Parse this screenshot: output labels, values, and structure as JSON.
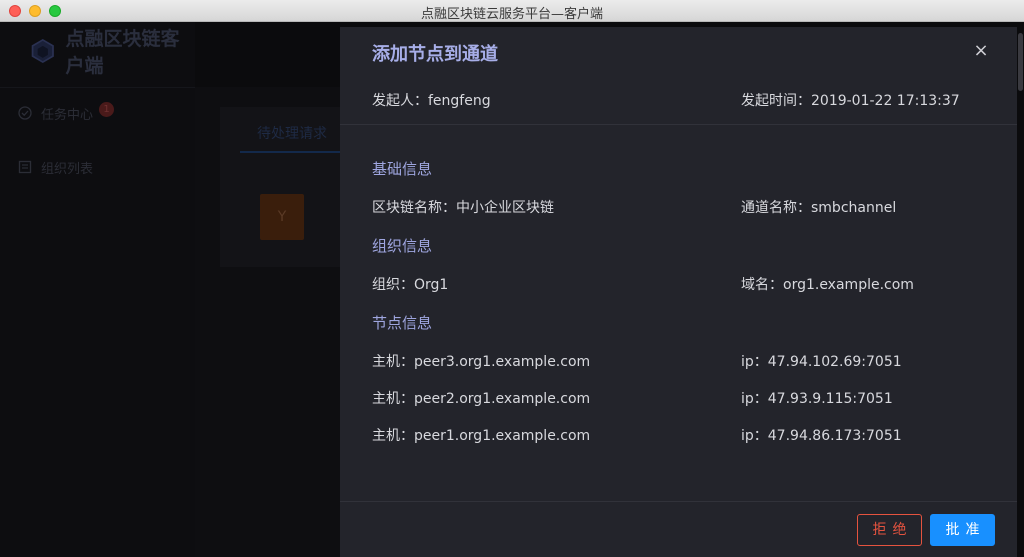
{
  "window": {
    "title": "点融区块链云服务平台—客户端"
  },
  "sidebar": {
    "logo_text": "点融区块链客户端",
    "items": [
      {
        "label": "任务中心",
        "badge": "1",
        "icon": "check-circle-icon"
      },
      {
        "label": "组织列表",
        "icon": "list-icon"
      }
    ]
  },
  "background": {
    "tab_label": "待处理请求",
    "avatar_letter": "Y"
  },
  "drawer": {
    "title": "添加节点到通道",
    "close_symbol": "×",
    "initiator": "发起人：fengfeng",
    "initiated_time": "发起时间：2019-01-22 17:13:37",
    "sections": {
      "basic": {
        "title": "基础信息",
        "chain_name": "区块链名称：中小企业区块链",
        "channel_name": "通道名称：smbchannel"
      },
      "org": {
        "title": "组织信息",
        "org": "组织：Org1",
        "domain": "域名：org1.example.com"
      },
      "nodes": {
        "title": "节点信息",
        "items": [
          {
            "host": "主机：peer3.org1.example.com",
            "ip": "ip：47.94.102.69:7051"
          },
          {
            "host": "主机：peer2.org1.example.com",
            "ip": "ip：47.93.9.115:7051"
          },
          {
            "host": "主机：peer1.org1.example.com",
            "ip": "ip：47.94.86.173:7051"
          }
        ]
      }
    },
    "buttons": {
      "reject": "拒绝",
      "approve": "批准"
    }
  },
  "colors": {
    "accent": "#1890ff",
    "danger": "#e5533f",
    "section_title": "#9fa6e0",
    "drawer_bg": "#23242b"
  }
}
